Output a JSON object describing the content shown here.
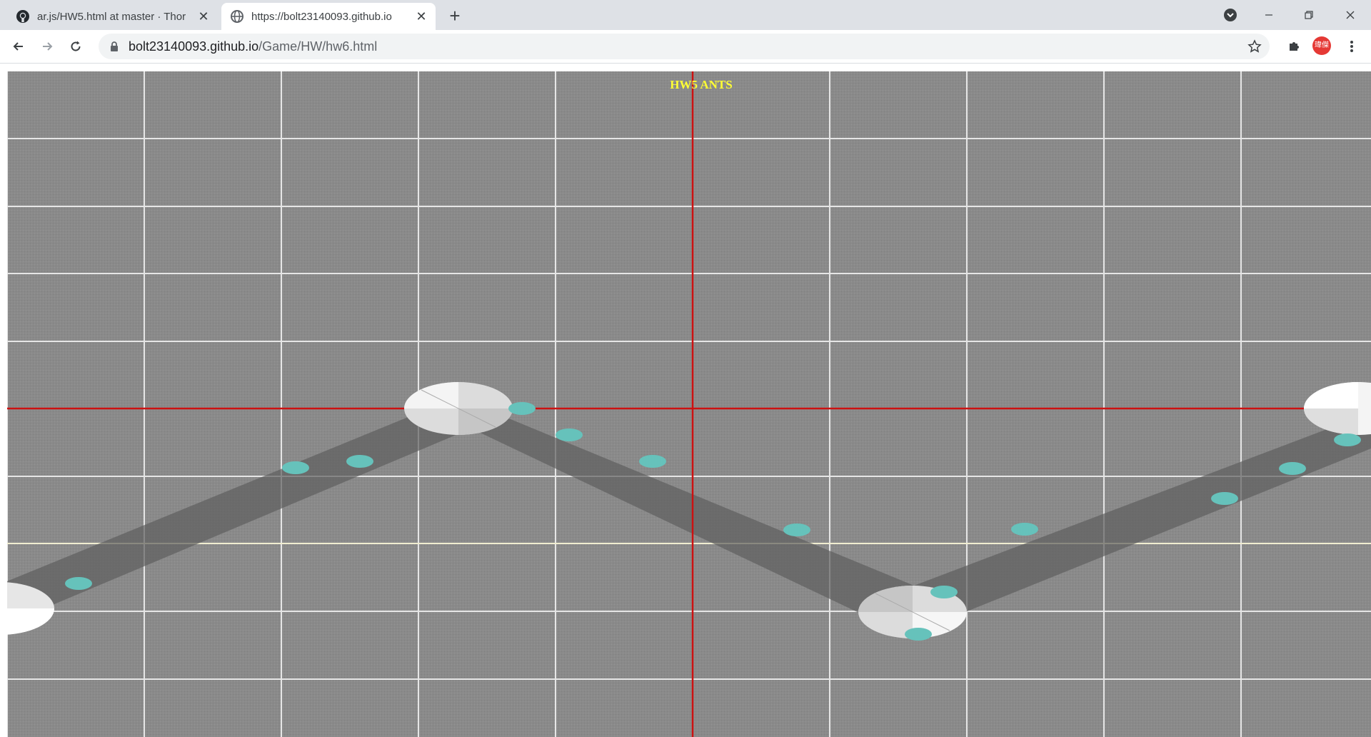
{
  "browser": {
    "tabs": [
      {
        "title": "ar.js/HW5.html at master · Thor",
        "icon": "github-icon",
        "active": false
      },
      {
        "title": "https://bolt23140093.github.io",
        "icon": "globe-icon",
        "active": true
      }
    ],
    "url_host": "bolt23140093.github.io",
    "url_path": "/Game/HW/hw6.html",
    "profile_initials": "瑋傑"
  },
  "page": {
    "title": "HW5 ANTS",
    "colors": {
      "background": "#8a8a8a",
      "grid": "#e6e6e6",
      "axis": "#cc1111",
      "path": "#5e5e5e",
      "ant": "#66c2bb",
      "title": "#ffff33"
    }
  }
}
